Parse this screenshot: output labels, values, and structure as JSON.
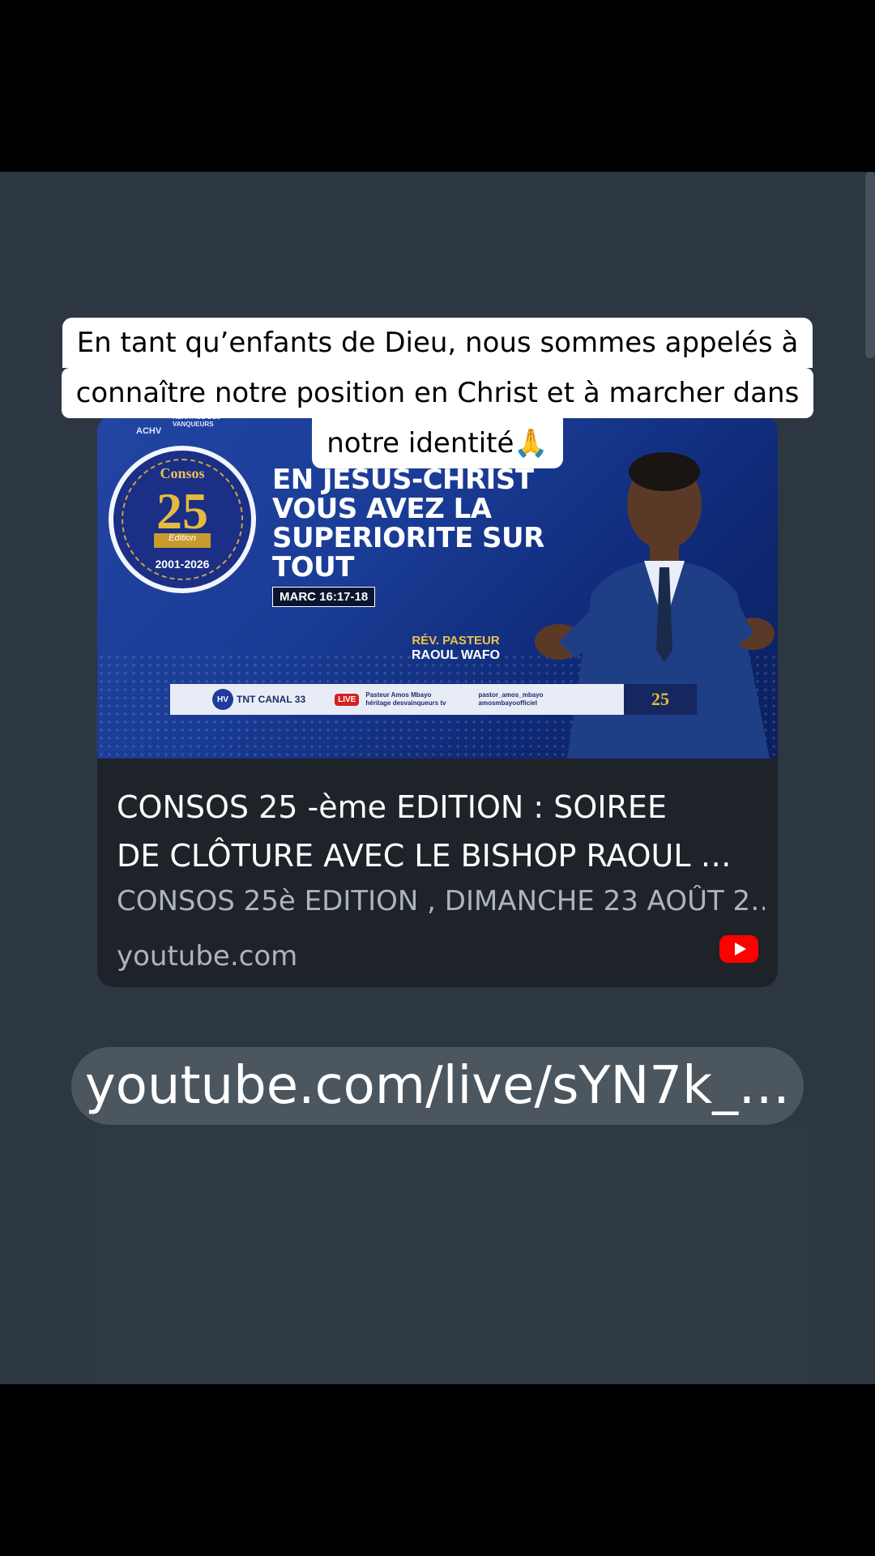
{
  "caption": {
    "line1": "En tant qu’enfants de Dieu, nous sommes appelés à",
    "line2": "connaître notre position en Christ et à marcher dans",
    "line3": "notre identité",
    "emoji": "🙏"
  },
  "thumbnail": {
    "brand": "ACHV",
    "brand_sub": "HERITAGE DES VANQUEURS",
    "badge_title": "Consos",
    "badge_number": "25",
    "badge_edition": "Edition",
    "badge_years": "2001-2026",
    "headline": "EN JESUS-CHRIST VOUS AVEZ LA SUPERIORITE SUR TOUT",
    "verse": "MARC 16:17-18",
    "speaker_title": "RÉV. PASTEUR",
    "speaker_name": "RAOUL WAFO",
    "strip_hv": "HV",
    "strip_tnt": "TNT CANAL 33",
    "strip_live": "LIVE",
    "strip_social1": "Pasteur Amos Mbayo",
    "strip_social2": "héritage desvainqueurs tv",
    "strip_social3": "pastor_amos_mbayo",
    "strip_social4": "amosmbayoofficiel",
    "strip_logo": "25"
  },
  "card": {
    "title_line1": "CONSOS 25 -ème EDITION : SOIREE",
    "title_line2": "DE CLÔTURE AVEC LE BISHOP RAOUL …",
    "description": "CONSOS 25è EDITION , DIMANCHE 23 AOÛT 2…",
    "domain": "youtube.com",
    "icon": "youtube-icon"
  },
  "url_pill": {
    "text": "youtube.com/live/sYN7k_…"
  },
  "colors": {
    "background": "#2d3741",
    "card": "#1d2329",
    "youtube_red": "#ff0000",
    "pill": "#4c565f"
  }
}
